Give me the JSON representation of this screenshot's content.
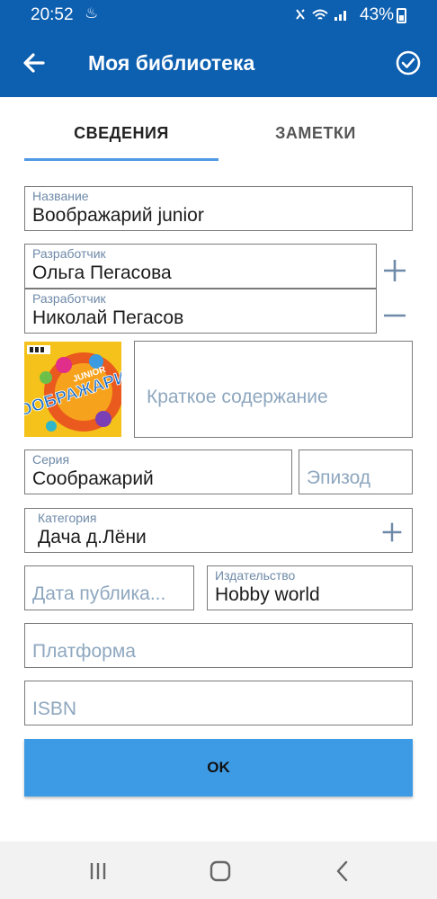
{
  "status_bar": {
    "time": "20:52",
    "battery": "43%"
  },
  "app_bar": {
    "title": "Моя библиотека"
  },
  "tabs": [
    {
      "label": "СВЕДЕНИЯ",
      "active": true
    },
    {
      "label": "ЗАМЕТКИ",
      "active": false
    }
  ],
  "form": {
    "name": {
      "label": "Название",
      "value": "Воображарий junior"
    },
    "developers": [
      {
        "label": "Разработчик",
        "value": "Ольга Пегасова"
      },
      {
        "label": "Разработчик",
        "value": "Николай Пегасов"
      }
    ],
    "summary": {
      "placeholder": "Краткое содержание"
    },
    "series": {
      "label": "Серия",
      "value": "Соображарий"
    },
    "episode": {
      "placeholder": "Эпизод"
    },
    "category": {
      "label": "Категория",
      "value": "Дача д.Лёни"
    },
    "publish_date": {
      "placeholder": "Дата публика..."
    },
    "publisher": {
      "label": "Издательство",
      "value": "Hobby world"
    },
    "platform": {
      "placeholder": "Платформа"
    },
    "isbn": {
      "placeholder": "ISBN"
    }
  },
  "cover": {
    "art_text": "ВООБРАЖАРИЙ",
    "art_sub": "JUNIOR"
  },
  "ok_button": {
    "label": "OK"
  },
  "colors": {
    "app_bar": "#0d5fb0",
    "accent": "#3d9be6",
    "tab_indicator": "#4f9ae3",
    "placeholder": "#8ea7bf"
  }
}
